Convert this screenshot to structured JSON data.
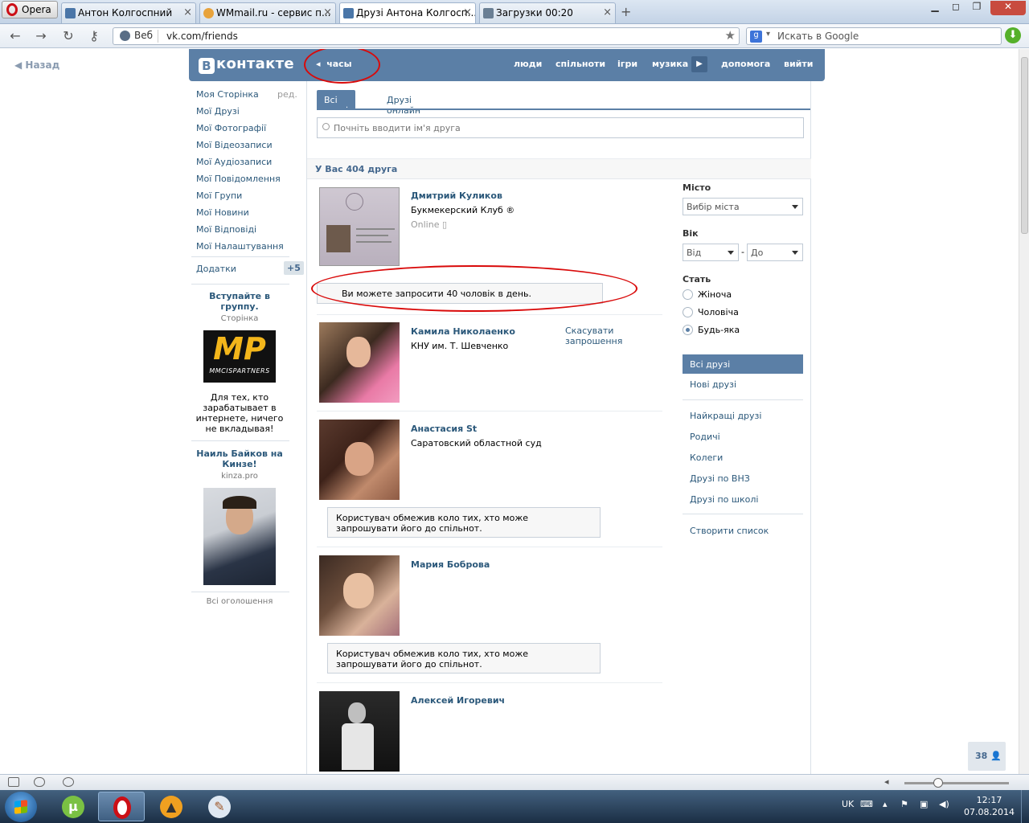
{
  "browser": {
    "menu_label": "Opera",
    "tabs": [
      {
        "label": "Антон Колгоспний",
        "favicon": "vk-icon"
      },
      {
        "label": "WMmail.ru - сервис п...",
        "favicon": "wmmail-icon"
      },
      {
        "label": "Друзі Антона Колгосп...",
        "favicon": "vk-icon",
        "active": true
      },
      {
        "label": "Загрузки 00:20",
        "favicon": "download-icon"
      }
    ],
    "address_mode": "Веб",
    "url": "vk.com/friends",
    "search_placeholder": "Искать в Google"
  },
  "page": {
    "back_label": "Назад",
    "header": {
      "logo_text": "контакте",
      "logo_letter": "В",
      "player_label": "часы",
      "nav": [
        "люди",
        "спільноти",
        "ігри",
        "музика",
        "допомога",
        "вийти"
      ]
    },
    "left_menu": {
      "items": [
        "Моя Сторінка",
        "Мої Друзі",
        "Мої Фотографії",
        "Мої Відеозаписи",
        "Мої Аудіозаписи",
        "Мої Повідомлення",
        "Мої Групи",
        "Мої Новини",
        "Мої Відповіді",
        "Мої Налаштування"
      ],
      "edit_label": "ред.",
      "apps_label": "Додатки",
      "apps_count": "+5"
    },
    "ads": [
      {
        "title": "Вступайте в группу.",
        "domain": "Сторінка",
        "image_big": "MP",
        "image_small": "MMCISPARTNERS",
        "text": "Для тех, кто зарабатывает в интернете, ничего не вкладывая!"
      },
      {
        "title": "Наиль Байков на Кинзе!",
        "domain": "kinza.pro"
      }
    ],
    "all_ads_label": "Всі оголошення",
    "friends": {
      "tabs": [
        "Всі друзі",
        "Друзі онлайн"
      ],
      "search_placeholder": "Почніть вводити ім'я друга",
      "count_text": "У Вас 404 друга",
      "list": [
        {
          "name": "Дмитрий Куликов",
          "sub": "Букмекерский Клуб ®",
          "status": "Online"
        },
        {
          "name": "Камила Николаенко",
          "sub": "КНУ им. Т. Шевченко",
          "action": "Скасувати запрошення"
        },
        {
          "name": "Анастасия St",
          "sub": "Саратовский областной суд"
        },
        {
          "name": "Мария Боброва",
          "sub": ""
        },
        {
          "name": "Алексей Игоревич",
          "sub": ""
        }
      ],
      "invite_limit_notice": "Ви можете запросити 40 чоловік в день.",
      "restricted_notice": "Користувач обмежив коло тих, хто може запрошувати його до спільнот."
    },
    "filters": {
      "city_label": "Місто",
      "city_value": "Вибір міста",
      "age_label": "Вік",
      "age_from": "Від",
      "age_sep": "-",
      "age_to": "До",
      "gender_label": "Стать",
      "gender_options": [
        "Жіноча",
        "Чоловіча",
        "Будь-яка"
      ],
      "gender_selected": "Будь-яка",
      "menu_active": "Всі друзі",
      "menu_items": [
        "Нові друзі",
        "Найкращі друзі",
        "Родичі",
        "Колеги",
        "Друзі по ВНЗ",
        "Друзі по школі"
      ],
      "create_list": "Створити список"
    },
    "online_count": "38"
  },
  "taskbar": {
    "lang": "UK",
    "time": "12:17",
    "date": "07.08.2014"
  },
  "colors": {
    "vk_blue": "#5b7fa6",
    "link": "#2b587a",
    "annotation_red": "#d90a0a"
  }
}
